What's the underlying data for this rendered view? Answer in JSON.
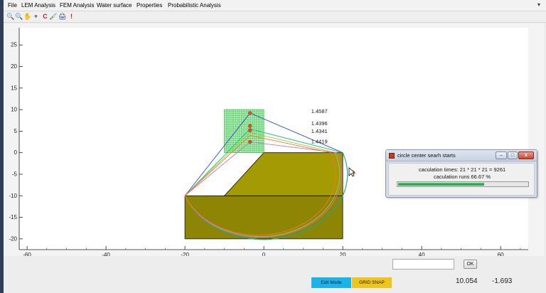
{
  "menu": {
    "items": [
      "File",
      "LEM Analysis",
      "FEM Analysis",
      "Water surface",
      "Properties",
      "Probabilistic Analysis"
    ],
    "close_glyph": "▾"
  },
  "toolbar": {
    "tools": [
      {
        "icon": "zoom-in-icon",
        "glyph": "🔍"
      },
      {
        "icon": "zoom-out-icon",
        "glyph": "🔍"
      },
      {
        "icon": "pan-hand-icon",
        "glyph": "✋"
      },
      {
        "icon": "data-cursor-icon",
        "glyph": "⌖"
      },
      {
        "icon": "letter-c-icon",
        "glyph": "C"
      },
      {
        "icon": "brush-icon",
        "glyph": "🖌"
      },
      {
        "icon": "printer-icon",
        "glyph": "🖨"
      },
      {
        "icon": "exclamation-icon",
        "glyph": "!"
      }
    ]
  },
  "chart_data": {
    "type": "line",
    "title": "",
    "xlabel": "",
    "ylabel": "",
    "xlim": [
      -62,
      67
    ],
    "ylim": [
      -22.5,
      29
    ],
    "xticks": [
      -60,
      -40,
      -20,
      0,
      20,
      40,
      60
    ],
    "yticks": [
      -20,
      -15,
      -10,
      -5,
      0,
      5,
      10,
      15,
      20,
      25
    ],
    "grid": false,
    "geometry": {
      "lower_layer": [
        [
          -20,
          -10
        ],
        [
          20,
          -10
        ],
        [
          20,
          -20
        ],
        [
          -20,
          -20
        ]
      ],
      "upper_layer": [
        [
          -10,
          -10
        ],
        [
          0,
          0
        ],
        [
          20,
          0
        ],
        [
          20,
          -10
        ]
      ],
      "colors": {
        "soil": "#a39a04",
        "soil_dark": "#8d8503"
      }
    },
    "center_grid": {
      "x_range": [
        -10,
        0
      ],
      "y_range": [
        0,
        10
      ],
      "divisions": 21,
      "color": "#1ec22e"
    },
    "slip_surfaces": [
      {
        "color": "#3a4ad0",
        "center": [
          -3.5,
          9.2
        ],
        "r": 25.5,
        "from": [
          -20,
          -10
        ],
        "to": [
          20,
          0
        ],
        "fos": "1.4587",
        "label_x": 12,
        "label_y": 9.2
      },
      {
        "color": "#1bb88a",
        "center": [
          -3.5,
          5.5
        ],
        "r": 22.5,
        "from": [
          -20,
          -10
        ],
        "to": [
          20,
          0
        ],
        "fos": "1.4396",
        "label_x": 12,
        "label_y": 6.4
      },
      {
        "color": "#8fcf3c",
        "center": [
          -3.5,
          4.7
        ],
        "r": 21.5,
        "from": [
          -20,
          -10
        ],
        "to": [
          18,
          0
        ],
        "fos": "1.4341",
        "label_x": 12,
        "label_y": 4.6
      },
      {
        "color": "#d56ac9",
        "center": [
          -3.5,
          2.5
        ],
        "r": 22.0,
        "from": [
          -20,
          -10
        ],
        "to": [
          18.5,
          0
        ],
        "fos": "1.4419",
        "label_x": 12,
        "label_y": 2.2
      },
      {
        "color": "#f07a20",
        "center": [
          -3.5,
          4.0
        ],
        "r": 20.5,
        "from": [
          -20,
          -10
        ],
        "to": [
          17,
          0
        ],
        "fos": "",
        "label_x": 0,
        "label_y": 0
      }
    ],
    "centers": [
      {
        "x": -3.5,
        "y": 9.2,
        "color": "#e05020"
      },
      {
        "x": -3.5,
        "y": 6.2,
        "color": "#e05020"
      },
      {
        "x": -3.5,
        "y": 5.2,
        "color": "#e05020"
      },
      {
        "x": -3.5,
        "y": 2.5,
        "color": "#e05020"
      }
    ],
    "yellow_marker": {
      "x": 22.5,
      "y": -4.6,
      "color": "#f2d21b"
    }
  },
  "dialog": {
    "title": "circle center searh starts",
    "line1": "caculation times: 21 * 21 * 21 = 9261",
    "line2": "caculation runs 66.67 %",
    "progress": 0.6667,
    "min_glyph": "–",
    "max_glyph": "□",
    "close_glyph": "x"
  },
  "controls": {
    "input_value": "",
    "ok_label": "OK",
    "edit_mode_label": "Edit Mode",
    "grid_snap_label": "GRID SNAP",
    "coord_x": "10.054",
    "coord_y": "-1.693",
    "accent_blue": "#19b4ea",
    "accent_yellow": "#f1c419"
  }
}
